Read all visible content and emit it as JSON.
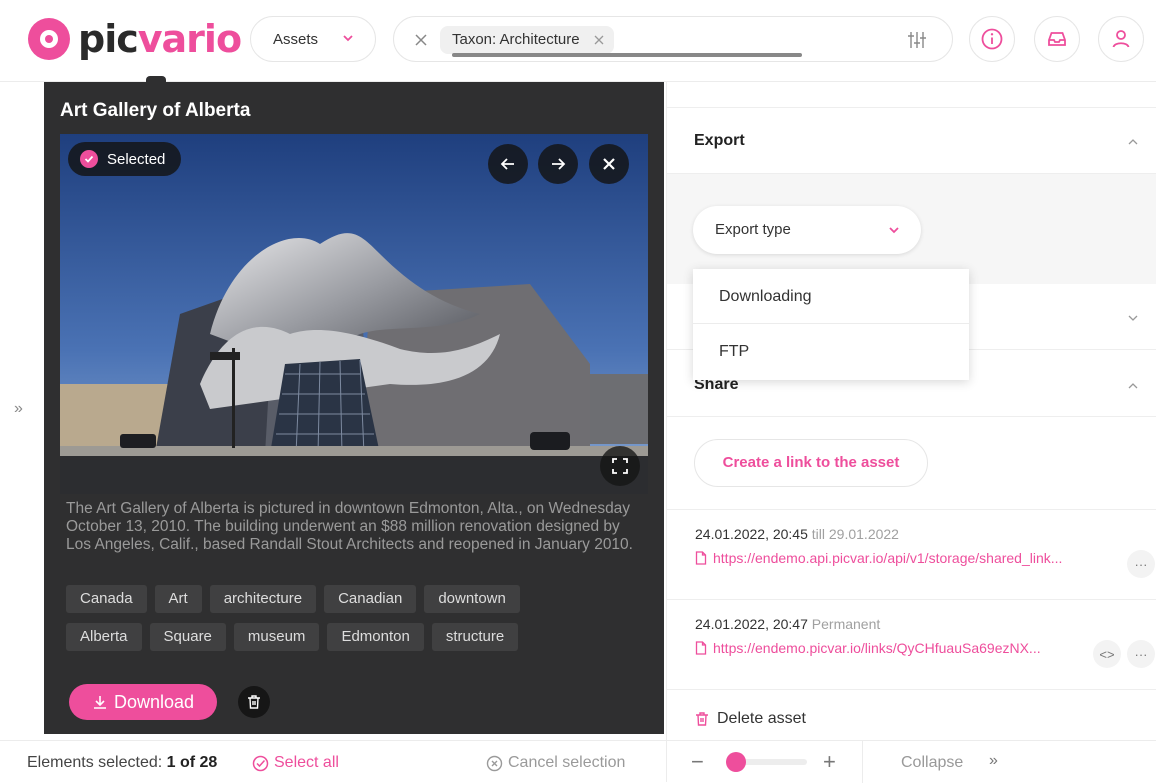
{
  "brand": {
    "logo_part1": "pic",
    "logo_part2": "vario",
    "accent": "#ee4e9c"
  },
  "header": {
    "assets_select": "Assets",
    "search_chip": "Taxon: Architecture"
  },
  "asset": {
    "title": "Art Gallery of Alberta",
    "selected_label": "Selected",
    "caption": "The Art Gallery of Alberta is pictured in downtown Edmonton, Alta., on Wednesday October 13, 2010. The building underwent an $88 million renovation designed by Los Angeles, Calif., based Randall Stout Architects and reopened in January 2010.",
    "tags_row1": [
      "Canada",
      "Art",
      "architecture",
      "Canadian",
      "downtown"
    ],
    "tags_row2": [
      "Alberta",
      "Square",
      "museum",
      "Edmonton",
      "structure"
    ],
    "download_label": "Download"
  },
  "bottom": {
    "elements_selected_label": "Elements selected:",
    "elements_selected_value": "1 of 28",
    "select_all": "Select all",
    "cancel_selection": "Cancel selection"
  },
  "panel": {
    "export_title": "Export",
    "export_type_placeholder": "Export type",
    "export_options": [
      "Downloading",
      "FTP"
    ],
    "share_title": "Share",
    "create_link_label": "Create a link to the asset",
    "links": [
      {
        "date": "24.01.2022, 20:45",
        "expiry": "till 29.01.2022",
        "url": "https://endemo.api.picvar.io/api/v1/storage/shared_link..."
      },
      {
        "date": "24.01.2022, 20:47",
        "expiry": "Permanent",
        "url": "https://endemo.picvar.io/links/QyCHfuauSa69ezNX..."
      }
    ],
    "delete_label": "Delete asset",
    "collapse_label": "Collapse"
  }
}
